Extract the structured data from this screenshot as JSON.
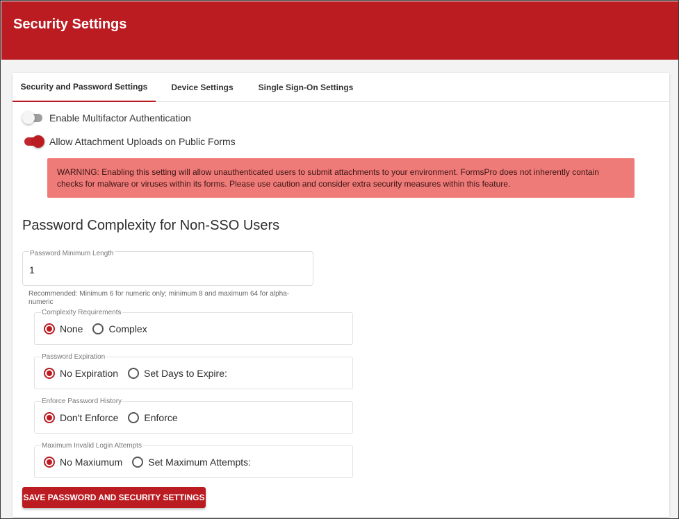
{
  "header": {
    "title": "Security Settings"
  },
  "tabs": [
    {
      "label": "Security and Password Settings",
      "active": true
    },
    {
      "label": "Device Settings",
      "active": false
    },
    {
      "label": "Single Sign-On Settings",
      "active": false
    }
  ],
  "toggles": {
    "mfa": {
      "label": "Enable Multifactor Authentication",
      "on": false
    },
    "attachments": {
      "label": "Allow Attachment Uploads on Public Forms",
      "on": true
    }
  },
  "warning": {
    "text": "WARNING: Enabling this setting will allow unauthenticated users to submit attachments to your environment. FormsPro does not inherently contain checks for malware or viruses within its forms. Please use caution and consider extra security measures within this feature."
  },
  "password_section": {
    "title": "Password Complexity for Non-SSO Users",
    "min_length": {
      "label": "Password Minimum Length",
      "value": "1",
      "hint": "Recommended: Minimum 6 for numeric only; minimum 8 and maximum 64 for alpha-numeric"
    },
    "groups": [
      {
        "label": "Complexity Requirements",
        "options": [
          "None",
          "Complex"
        ],
        "selected": 0
      },
      {
        "label": "Password Expiration",
        "options": [
          "No Expiration",
          "Set Days to Expire:"
        ],
        "selected": 0
      },
      {
        "label": "Enforce Password History",
        "options": [
          "Don't Enforce",
          "Enforce"
        ],
        "selected": 0
      },
      {
        "label": "Maximum Invalid Login Attempts",
        "options": [
          "No Maxiumum",
          "Set Maximum Attempts:"
        ],
        "selected": 0
      }
    ]
  },
  "save_button": {
    "label": "SAVE PASSWORD AND SECURITY SETTINGS"
  },
  "colors": {
    "brand": "#bb1c22",
    "warning_bg": "#ef7b78"
  }
}
